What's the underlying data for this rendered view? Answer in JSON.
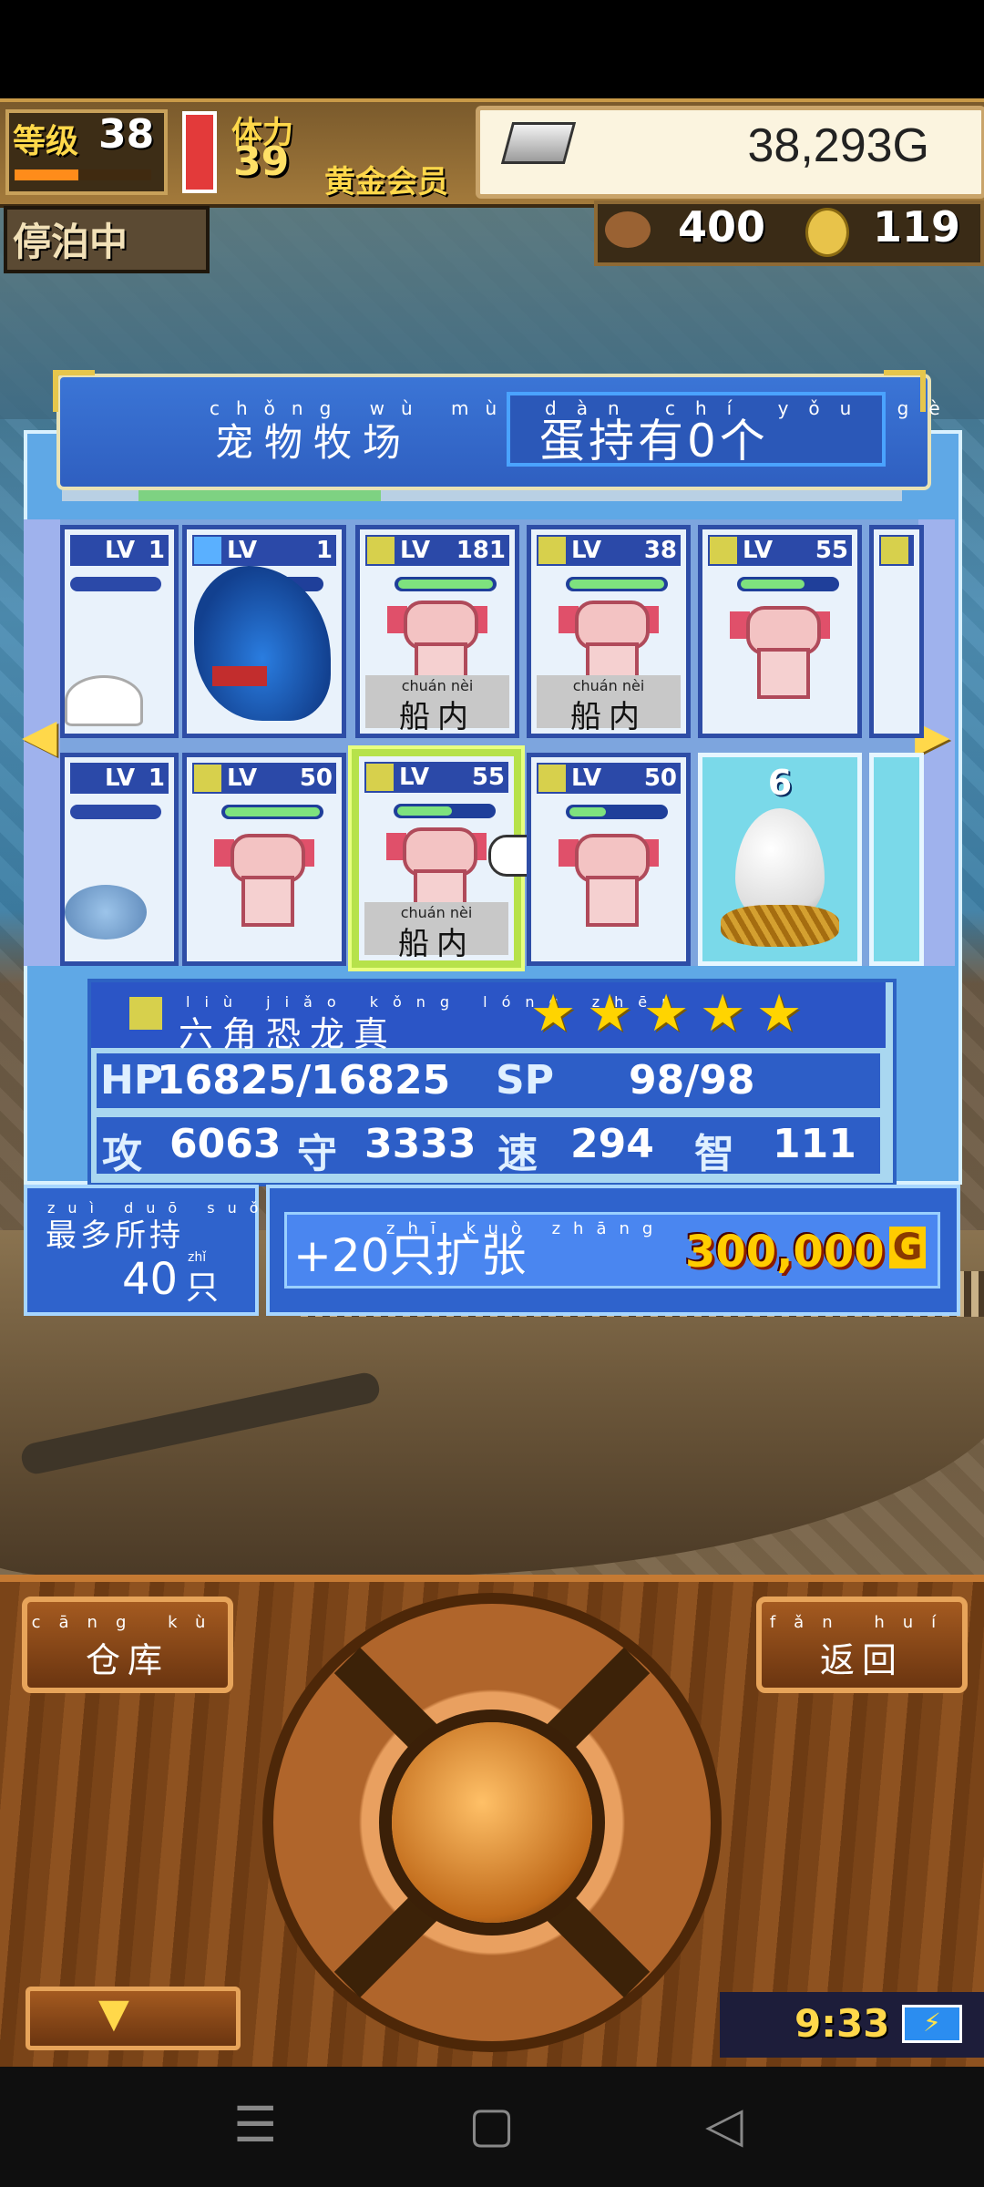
{
  "hud": {
    "level_label": "等级",
    "level": "38",
    "stamina_label": "体力",
    "stamina": "39",
    "membership": "黄金会员",
    "gold": "38,293G",
    "dock_status": "停泊中",
    "food": "400",
    "medals": "119"
  },
  "ranch": {
    "title_ruby": "chǒng wù mù chǎng",
    "title": "宠物牧场",
    "eggs_ruby": "dàn chí yǒu gè",
    "eggs_held": "蛋持有0个",
    "cards_row1": [
      {
        "lv_label": "LV",
        "lv": "1",
        "type": "slime"
      },
      {
        "lv_label": "LV",
        "lv": "1",
        "type": "dino"
      },
      {
        "lv_label": "LV",
        "lv": "181",
        "type": "axolotl",
        "tag_ruby": "chuán nèi",
        "tag": "船内"
      },
      {
        "lv_label": "LV",
        "lv": "38",
        "type": "axolotl",
        "tag_ruby": "chuán nèi",
        "tag": "船内"
      },
      {
        "lv_label": "LV",
        "lv": "55",
        "type": "axolotl"
      }
    ],
    "cards_row2": [
      {
        "lv_label": "LV",
        "lv": "1",
        "type": "rock"
      },
      {
        "lv_label": "LV",
        "lv": "50",
        "type": "axolotl"
      },
      {
        "lv_label": "LV",
        "lv": "55",
        "type": "axolotl",
        "tag_ruby": "chuán nèi",
        "tag": "船内",
        "selected": true
      },
      {
        "lv_label": "LV",
        "lv": "50",
        "type": "axolotl"
      },
      {
        "type": "egg",
        "count": "6"
      }
    ]
  },
  "info": {
    "name_ruby": "liù jiǎo kǒng lóng zhēn",
    "name": "六角恐龙真",
    "stars": 5,
    "hp_label": "HP",
    "hp": "16825/16825",
    "sp_label": "SP",
    "sp": "98/98",
    "atk_label": "攻",
    "atk": "6063",
    "def_label": "守",
    "def": "3333",
    "spd_label": "速",
    "spd": "294",
    "int_label": "智",
    "int": "111"
  },
  "capacity": {
    "ruby": "zuì duō suǒ chí",
    "label": "最多所持",
    "value": "40",
    "unit_ruby": "zhǐ",
    "unit": "只"
  },
  "expand": {
    "label": "+20只扩张",
    "ruby": "zhī kuò zhāng",
    "price": "300,000",
    "currency": "G"
  },
  "controls": {
    "warehouse_ruby": "cāng kù",
    "warehouse": "仓库",
    "back_ruby": "fǎn huí",
    "back": "返回",
    "down_icon": "▼"
  },
  "clock": "9:33",
  "battery_icon": "⚡",
  "nav": {
    "menu_icon": "☰",
    "home_icon": "▢",
    "back_icon": "◁"
  }
}
